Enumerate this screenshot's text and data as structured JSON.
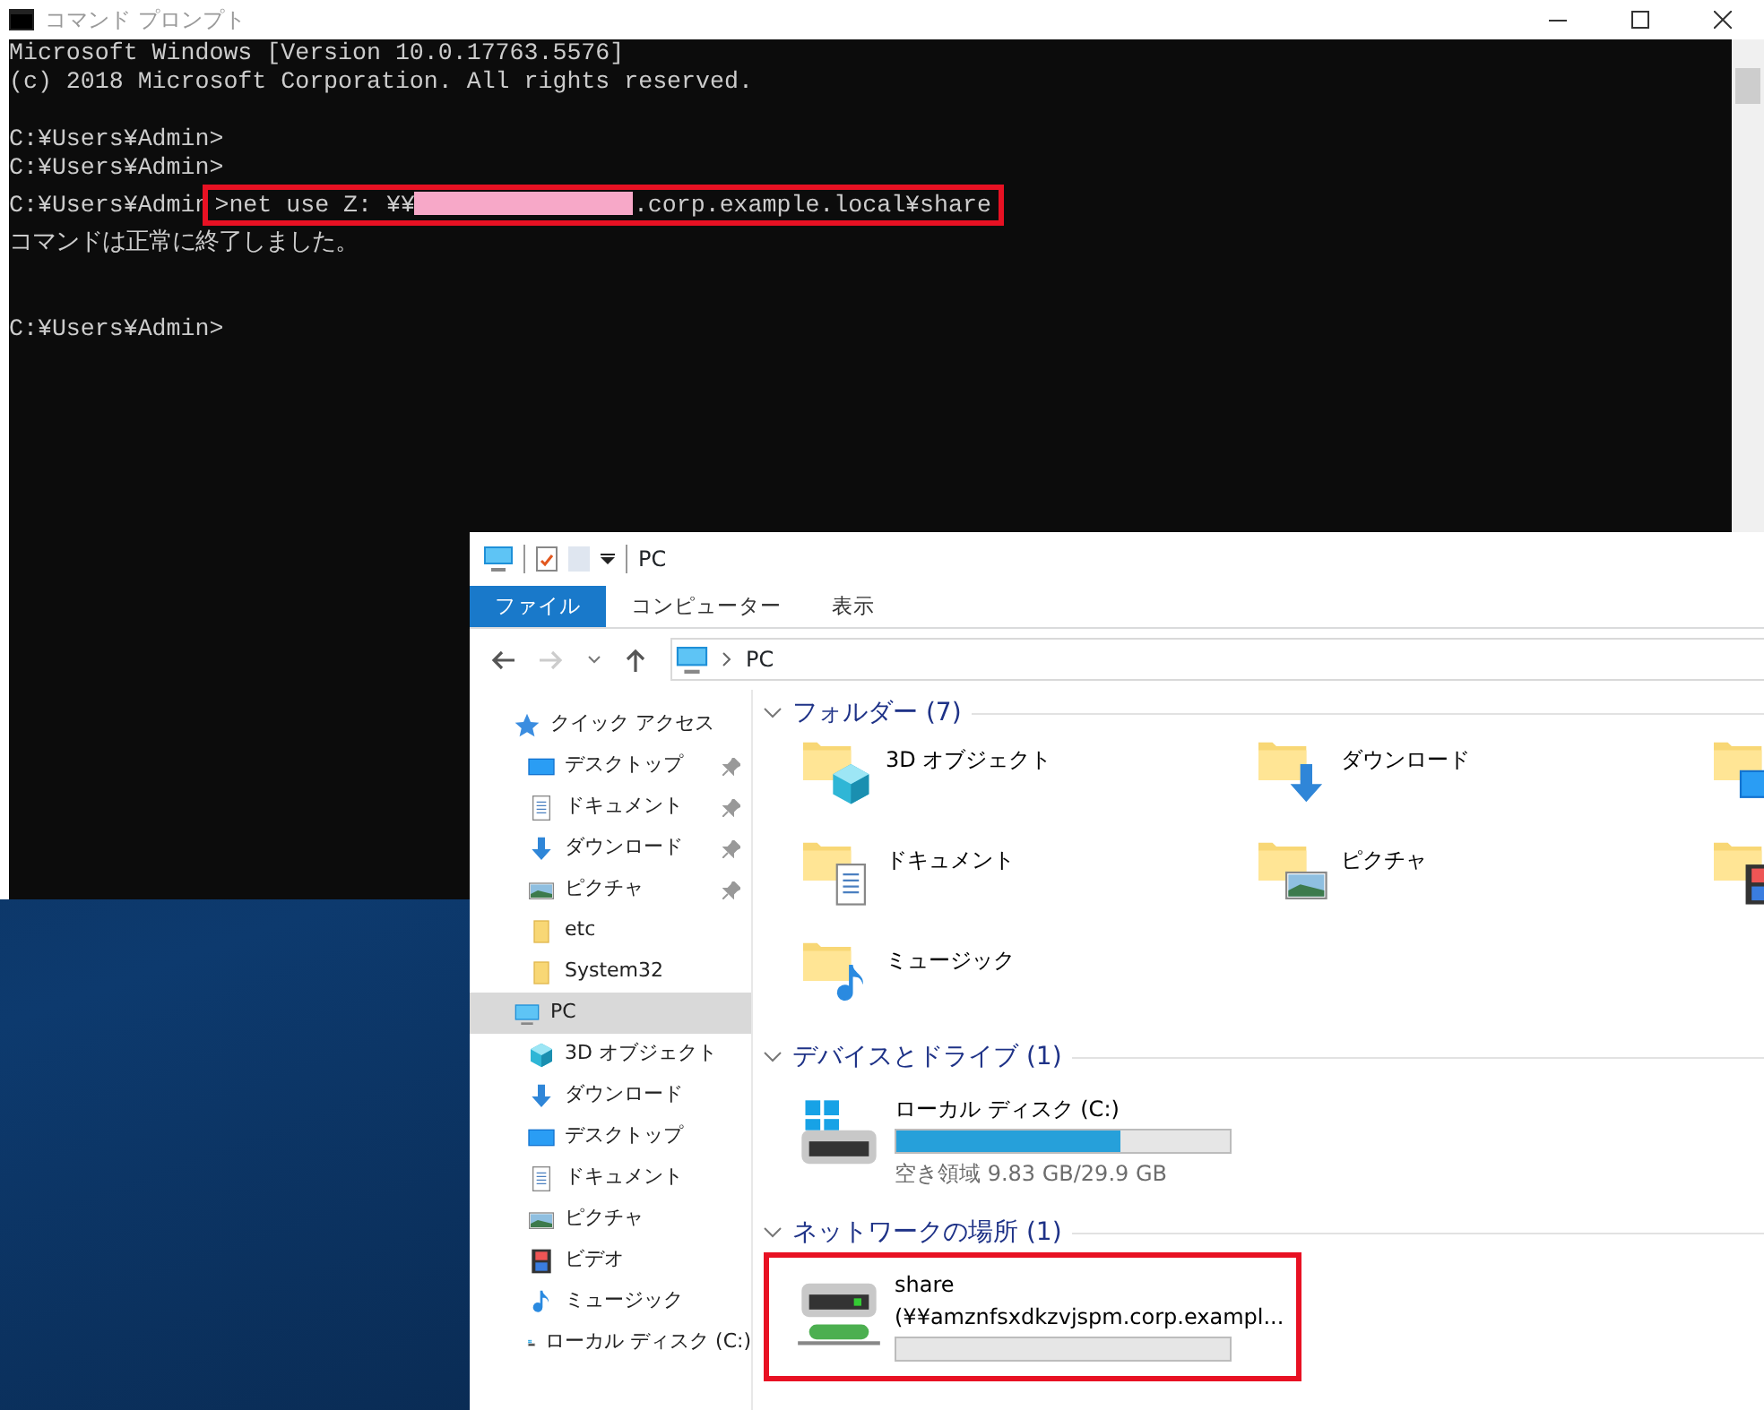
{
  "console": {
    "title": "コマンド プロンプト",
    "lines": [
      {
        "kind": "text",
        "text": "Microsoft Windows [Version 10.0.17763.5576]"
      },
      {
        "kind": "text",
        "text": "(c) 2018 Microsoft Corporation. All rights reserved."
      },
      {
        "kind": "blank"
      },
      {
        "kind": "text",
        "text": "C:¥Users¥Admin>"
      },
      {
        "kind": "text",
        "text": "C:¥Users¥Admin>"
      },
      {
        "kind": "command",
        "prompt": "C:¥Users¥Admin",
        "before": ">net use Z: ¥¥",
        "after": ".corp.example.local¥share",
        "highlighted": true
      },
      {
        "kind": "text",
        "text": "コマンドは正常に終了しました。"
      },
      {
        "kind": "blank"
      },
      {
        "kind": "blank"
      },
      {
        "kind": "text",
        "text": "C:¥Users¥Admin>"
      }
    ]
  },
  "explorer": {
    "title": "PC",
    "ribbon_tabs": [
      {
        "label": "ファイル",
        "selected": true
      },
      {
        "label": "コンピューター",
        "selected": false
      },
      {
        "label": "表示",
        "selected": false
      }
    ],
    "address": "PC",
    "sidebar": [
      {
        "label": "クイック アクセス",
        "kind": "star",
        "selected": false,
        "children": [
          {
            "label": "デスクトップ",
            "kind": "desktop",
            "pinned": true,
            "selected": false
          },
          {
            "label": "ドキュメント",
            "kind": "documents",
            "pinned": true,
            "selected": false
          },
          {
            "label": "ダウンロード",
            "kind": "download",
            "pinned": true,
            "selected": false
          },
          {
            "label": "ピクチャ",
            "kind": "pictures",
            "pinned": true,
            "selected": false
          },
          {
            "label": "etc",
            "kind": "folder",
            "pinned": false,
            "selected": false
          },
          {
            "label": "System32",
            "kind": "folder",
            "pinned": false,
            "selected": false
          }
        ]
      },
      {
        "label": "PC",
        "kind": "pc",
        "selected": true,
        "children": [
          {
            "label": "3D オブジェクト",
            "kind": "objects",
            "pinned": false,
            "selected": false
          },
          {
            "label": "ダウンロード",
            "kind": "download",
            "pinned": false,
            "selected": false
          },
          {
            "label": "デスクトップ",
            "kind": "desktop",
            "pinned": false,
            "selected": false
          },
          {
            "label": "ドキュメント",
            "kind": "documents",
            "pinned": false,
            "selected": false
          },
          {
            "label": "ピクチャ",
            "kind": "pictures",
            "pinned": false,
            "selected": false
          },
          {
            "label": "ビデオ",
            "kind": "videos",
            "pinned": false,
            "selected": false
          },
          {
            "label": "ミュージック",
            "kind": "music",
            "pinned": false,
            "selected": false
          },
          {
            "label": "ローカル ディスク (C:)",
            "kind": "drive",
            "pinned": false,
            "selected": false
          }
        ]
      }
    ],
    "sections": [
      {
        "kind": "folders",
        "title": "フォルダー (7)",
        "items": [
          {
            "label": "3D オブジェクト",
            "kind": "objects"
          },
          {
            "label": "ダウンロード",
            "kind": "download"
          },
          {
            "kind": "desktop"
          },
          {
            "label": "ドキュメント",
            "kind": "documents"
          },
          {
            "label": "ピクチャ",
            "kind": "pictures"
          },
          {
            "kind": "videos"
          },
          {
            "label": "ミュージック",
            "kind": "music"
          }
        ]
      },
      {
        "kind": "drives",
        "title": "デバイスとドライブ (1)",
        "items": [
          {
            "label": "ローカル ディスク (C:)",
            "kind": "drive",
            "level": 0.67,
            "detail": "空き領域 9.83 GB/29.9 GB",
            "highlighted": false
          }
        ]
      },
      {
        "kind": "drives",
        "title": "ネットワークの場所 (1)",
        "items": [
          {
            "label": "share",
            "sublabel": "(¥¥amznfsxdkzvjspm.corp.exampl...",
            "kind": "netdrive",
            "level": 0,
            "highlighted": true
          }
        ]
      }
    ]
  }
}
